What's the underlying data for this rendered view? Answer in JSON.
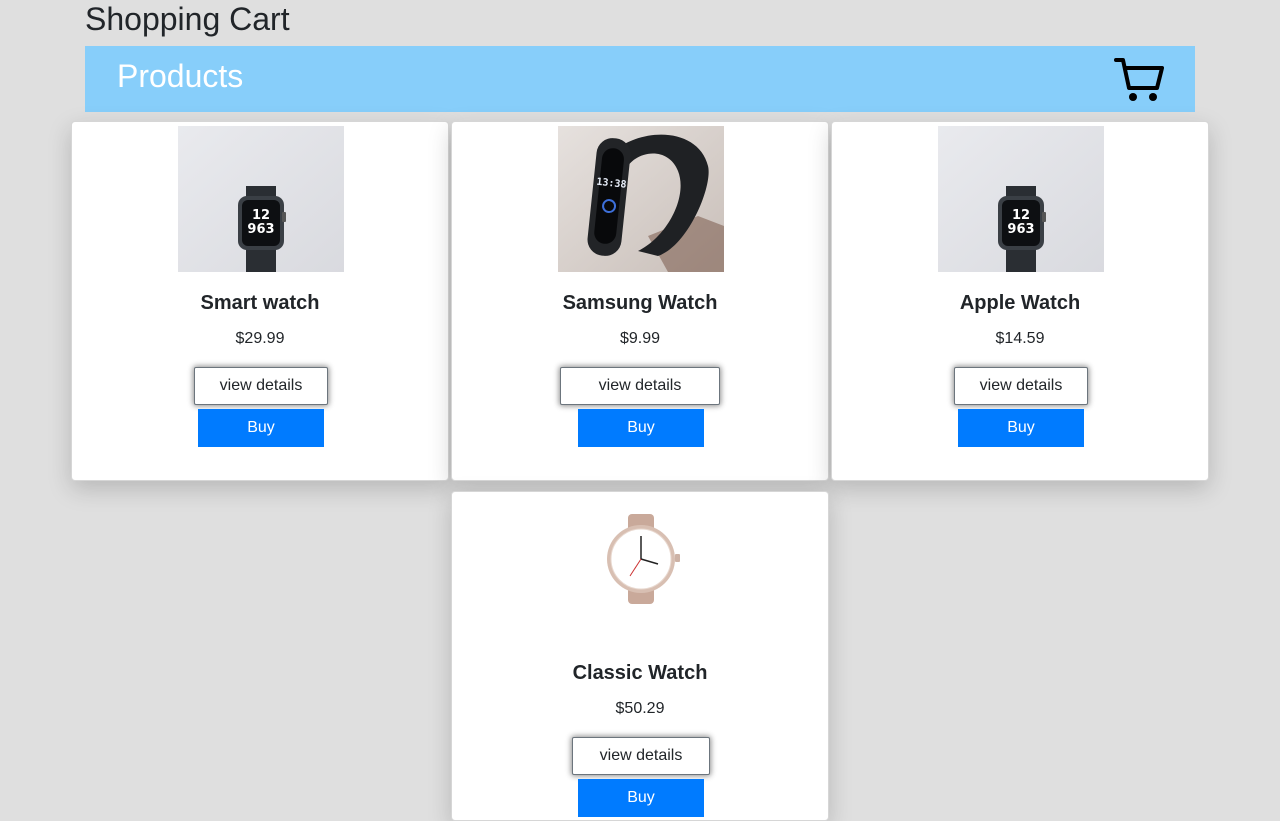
{
  "page": {
    "title": "Shopping Cart"
  },
  "header": {
    "title": "Products",
    "cart_icon": "shopping-cart-icon"
  },
  "colors": {
    "background": "#dfdfdf",
    "header_bar": "#87cefa",
    "buy_button": "#007bff"
  },
  "products": [
    {
      "name": "Smart watch",
      "price": "$29.99",
      "details_label": "view details",
      "buy_label": "Buy"
    },
    {
      "name": "Samsung Watch",
      "price": "$9.99",
      "details_label": "view details",
      "buy_label": "Buy"
    },
    {
      "name": "Apple Watch",
      "price": "$14.59",
      "details_label": "view details",
      "buy_label": "Buy"
    },
    {
      "name": "Classic Watch",
      "price": "$50.29",
      "details_label": "view details",
      "buy_label": "Buy"
    }
  ]
}
